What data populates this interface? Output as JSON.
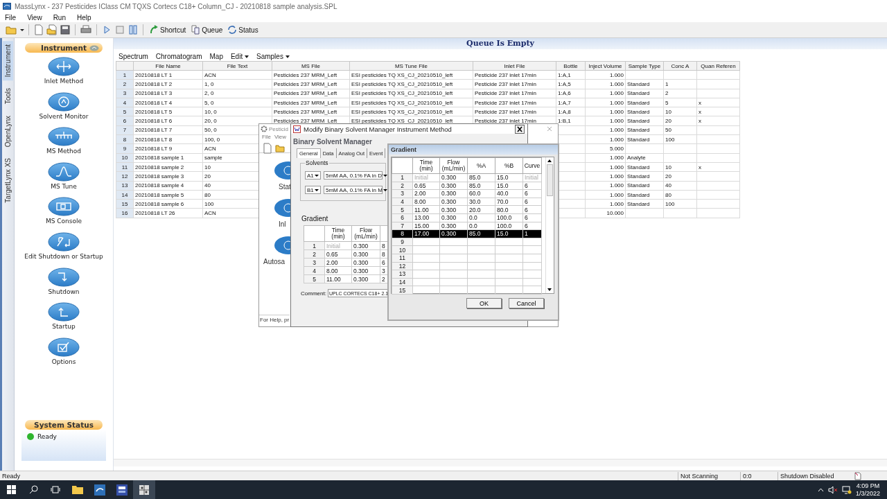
{
  "window": {
    "title": "MassLynx - 237 Pesticides IClass CM TQXS Cortecs C18+ Column_CJ - 20210818 sample analysis.SPL"
  },
  "menu": [
    "File",
    "View",
    "Run",
    "Help"
  ],
  "toolbar_buttons": [
    "Shortcut",
    "Queue",
    "Status"
  ],
  "side_tabs": [
    {
      "label": "Instrument",
      "selected": true
    },
    {
      "label": "Tools",
      "selected": false
    },
    {
      "label": "OpenLynx",
      "selected": false
    },
    {
      "label": "TargetLynx XS",
      "selected": false
    }
  ],
  "instrument_panel": {
    "title": "Instrument",
    "items": [
      "Inlet Method",
      "Solvent Monitor",
      "MS Method",
      "MS Tune",
      "MS Console",
      "Edit Shutdown or Startup",
      "Shutdown",
      "Startup",
      "Options"
    ]
  },
  "system_status": {
    "title": "System Status",
    "status": "Ready"
  },
  "banner": "Queue Is Empty",
  "queue_menu": [
    {
      "label": "Spectrum",
      "dropdown": false
    },
    {
      "label": "Chromatogram",
      "dropdown": false
    },
    {
      "label": "Map",
      "dropdown": false
    },
    {
      "label": "Edit",
      "dropdown": true
    },
    {
      "label": "Samples",
      "dropdown": true
    }
  ],
  "table": {
    "columns": [
      "",
      "File Name",
      "File Text",
      "MS File",
      "MS Tune File",
      "Inlet File",
      "Bottle",
      "Inject Volume",
      "Sample Type",
      "Conc A",
      "Quan Referen"
    ],
    "rows": [
      [
        "1",
        "20210818 LT 1",
        "ACN",
        "Pesticides 237 MRM_Left",
        "ESI pesticides TQ XS_CJ_20210510_left",
        "Pesticide 237 inlet 17min",
        "1:A,1",
        "1.000",
        null,
        null,
        null
      ],
      [
        "2",
        "20210818 LT 2",
        "1, 0",
        "Pesticides 237 MRM_Left",
        "ESI pesticides TQ XS_CJ_20210510_left",
        "Pesticide 237 inlet 17min",
        "1:A,5",
        "1.000",
        "Standard",
        "1",
        null
      ],
      [
        "3",
        "20210818 LT 3",
        "2, 0",
        "Pesticides 237 MRM_Left",
        "ESI pesticides TQ XS_CJ_20210510_left",
        "Pesticide 237 inlet 17min",
        "1:A,6",
        "1.000",
        "Standard",
        "2",
        null
      ],
      [
        "4",
        "20210818 LT 4",
        "5, 0",
        "Pesticides 237 MRM_Left",
        "ESI pesticides TQ XS_CJ_20210510_left",
        "Pesticide 237 inlet 17min",
        "1:A,7",
        "1.000",
        "Standard",
        "5",
        "x"
      ],
      [
        "5",
        "20210818 LT 5",
        "10, 0",
        "Pesticides 237 MRM_Left",
        "ESI pesticides TQ XS_CJ_20210510_left",
        "Pesticide 237 inlet 17min",
        "1:A,8",
        "1.000",
        "Standard",
        "10",
        "x"
      ],
      [
        "6",
        "20210818 LT 6",
        "20, 0",
        "Pesticides 237 MRM_Left",
        "ESI pesticides TQ XS_CJ_20210510_left",
        "Pesticide 237 inlet 17min",
        "1:B,1",
        "1.000",
        "Standard",
        "20",
        "x"
      ],
      [
        "7",
        "20210818 LT 7",
        "50, 0",
        null,
        null,
        null,
        null,
        "1.000",
        "Standard",
        "50",
        null
      ],
      [
        "8",
        "20210818 LT 8",
        "100, 0",
        null,
        null,
        null,
        null,
        "1.000",
        "Standard",
        "100",
        null
      ],
      [
        "9",
        "20210818 LT 9",
        "ACN",
        null,
        null,
        null,
        null,
        "5.000",
        null,
        null,
        null
      ],
      [
        "10",
        "20210818 sample 1",
        "sample",
        null,
        null,
        null,
        null,
        "1.000",
        "Analyte",
        null,
        null
      ],
      [
        "11",
        "20210818 sample 2",
        "10",
        null,
        null,
        null,
        null,
        "1.000",
        "Standard",
        "10",
        "x"
      ],
      [
        "12",
        "20210818 sample 3",
        "20",
        null,
        null,
        null,
        null,
        "1.000",
        "Standard",
        "20",
        null
      ],
      [
        "13",
        "20210818 sample 4",
        "40",
        null,
        null,
        null,
        null,
        "1.000",
        "Standard",
        "40",
        null
      ],
      [
        "14",
        "20210818 sample 5",
        "80",
        null,
        null,
        null,
        null,
        "1.000",
        "Standard",
        "80",
        null
      ],
      [
        "15",
        "20210818 sample 6",
        "100",
        null,
        null,
        null,
        null,
        "1.000",
        "Standard",
        "100",
        null
      ],
      [
        "16",
        "20210818 LT 26",
        "ACN",
        null,
        null,
        null,
        null,
        "10.000",
        null,
        null,
        null
      ]
    ]
  },
  "status_bar": [
    "Ready",
    "Not Scanning",
    "0:0",
    "Shutdown Disabled"
  ],
  "taskbar": {
    "time": "4:09 PM",
    "date": "1/3/2022"
  },
  "back_window": {
    "title": "Pesticid",
    "menu": [
      "File",
      "View"
    ],
    "items": [
      "Stat",
      "Inl",
      "Autosa"
    ],
    "status": "For Help, pr"
  },
  "method_dialog": {
    "title": "Modify Binary Solvent Manager Instrument Method",
    "heading": "Binary Solvent Manager",
    "tabs": [
      {
        "label": "General",
        "selected": true
      },
      {
        "label": "Data",
        "selected": false
      },
      {
        "label": "Analog Out",
        "selected": false
      },
      {
        "label": "Event",
        "selected": false
      }
    ],
    "solvents_label": "Solvents",
    "solvents": [
      {
        "channel": "A1",
        "name": "5mM AA, 0.1% FA in D'"
      },
      {
        "channel": "B1",
        "name": "5mM AA, 0.1% FA in M"
      }
    ],
    "gradient_label": "Gradient",
    "gradient_columns": [
      "Time (min)",
      "Flow (mL/min)"
    ],
    "gradient_rows": [
      {
        "no": "1",
        "time": "Initial",
        "flow": "0.300",
        "col3": "8",
        "initial": true
      },
      {
        "no": "2",
        "time": "0.65",
        "flow": "0.300",
        "col3": "8",
        "initial": false
      },
      {
        "no": "3",
        "time": "2.00",
        "flow": "0.300",
        "col3": "6",
        "initial": false
      },
      {
        "no": "4",
        "time": "8.00",
        "flow": "0.300",
        "col3": "3",
        "initial": false
      },
      {
        "no": "5",
        "time": "11.00",
        "flow": "0.300",
        "col3": "2",
        "initial": false
      }
    ],
    "comment_label": "Comment:",
    "comment": "UPLC CORTECS C18+ 2.1"
  },
  "gradient_dialog": {
    "title": "Gradient",
    "columns": [
      "Time (min)",
      "Flow (mL/min)",
      "%A",
      "%B",
      "Curve"
    ],
    "rows": [
      {
        "no": "1",
        "time": "Initial",
        "flow": "0.300",
        "a": "85.0",
        "b": "15.0",
        "curve": "Initial",
        "initial": true,
        "selected": false
      },
      {
        "no": "2",
        "time": "0.65",
        "flow": "0.300",
        "a": "85.0",
        "b": "15.0",
        "curve": "6",
        "initial": false,
        "selected": false
      },
      {
        "no": "3",
        "time": "2.00",
        "flow": "0.300",
        "a": "60.0",
        "b": "40.0",
        "curve": "6",
        "initial": false,
        "selected": false
      },
      {
        "no": "4",
        "time": "8.00",
        "flow": "0.300",
        "a": "30.0",
        "b": "70.0",
        "curve": "6",
        "initial": false,
        "selected": false
      },
      {
        "no": "5",
        "time": "11.00",
        "flow": "0.300",
        "a": "20.0",
        "b": "80.0",
        "curve": "6",
        "initial": false,
        "selected": false
      },
      {
        "no": "6",
        "time": "13.00",
        "flow": "0.300",
        "a": "0.0",
        "b": "100.0",
        "curve": "6",
        "initial": false,
        "selected": false
      },
      {
        "no": "7",
        "time": "15.00",
        "flow": "0.300",
        "a": "0.0",
        "b": "100.0",
        "curve": "6",
        "initial": false,
        "selected": false
      },
      {
        "no": "8",
        "time": "17.00",
        "flow": "0.300",
        "a": "85.0",
        "b": "15.0",
        "curve": "1",
        "initial": false,
        "selected": true
      },
      {
        "no": "9",
        "selected": false
      },
      {
        "no": "10",
        "selected": false
      },
      {
        "no": "11",
        "selected": false
      },
      {
        "no": "12",
        "selected": false
      },
      {
        "no": "13",
        "selected": false
      },
      {
        "no": "14",
        "selected": false
      },
      {
        "no": "15",
        "selected": false
      }
    ],
    "buttons": [
      "OK",
      "Cancel"
    ]
  }
}
